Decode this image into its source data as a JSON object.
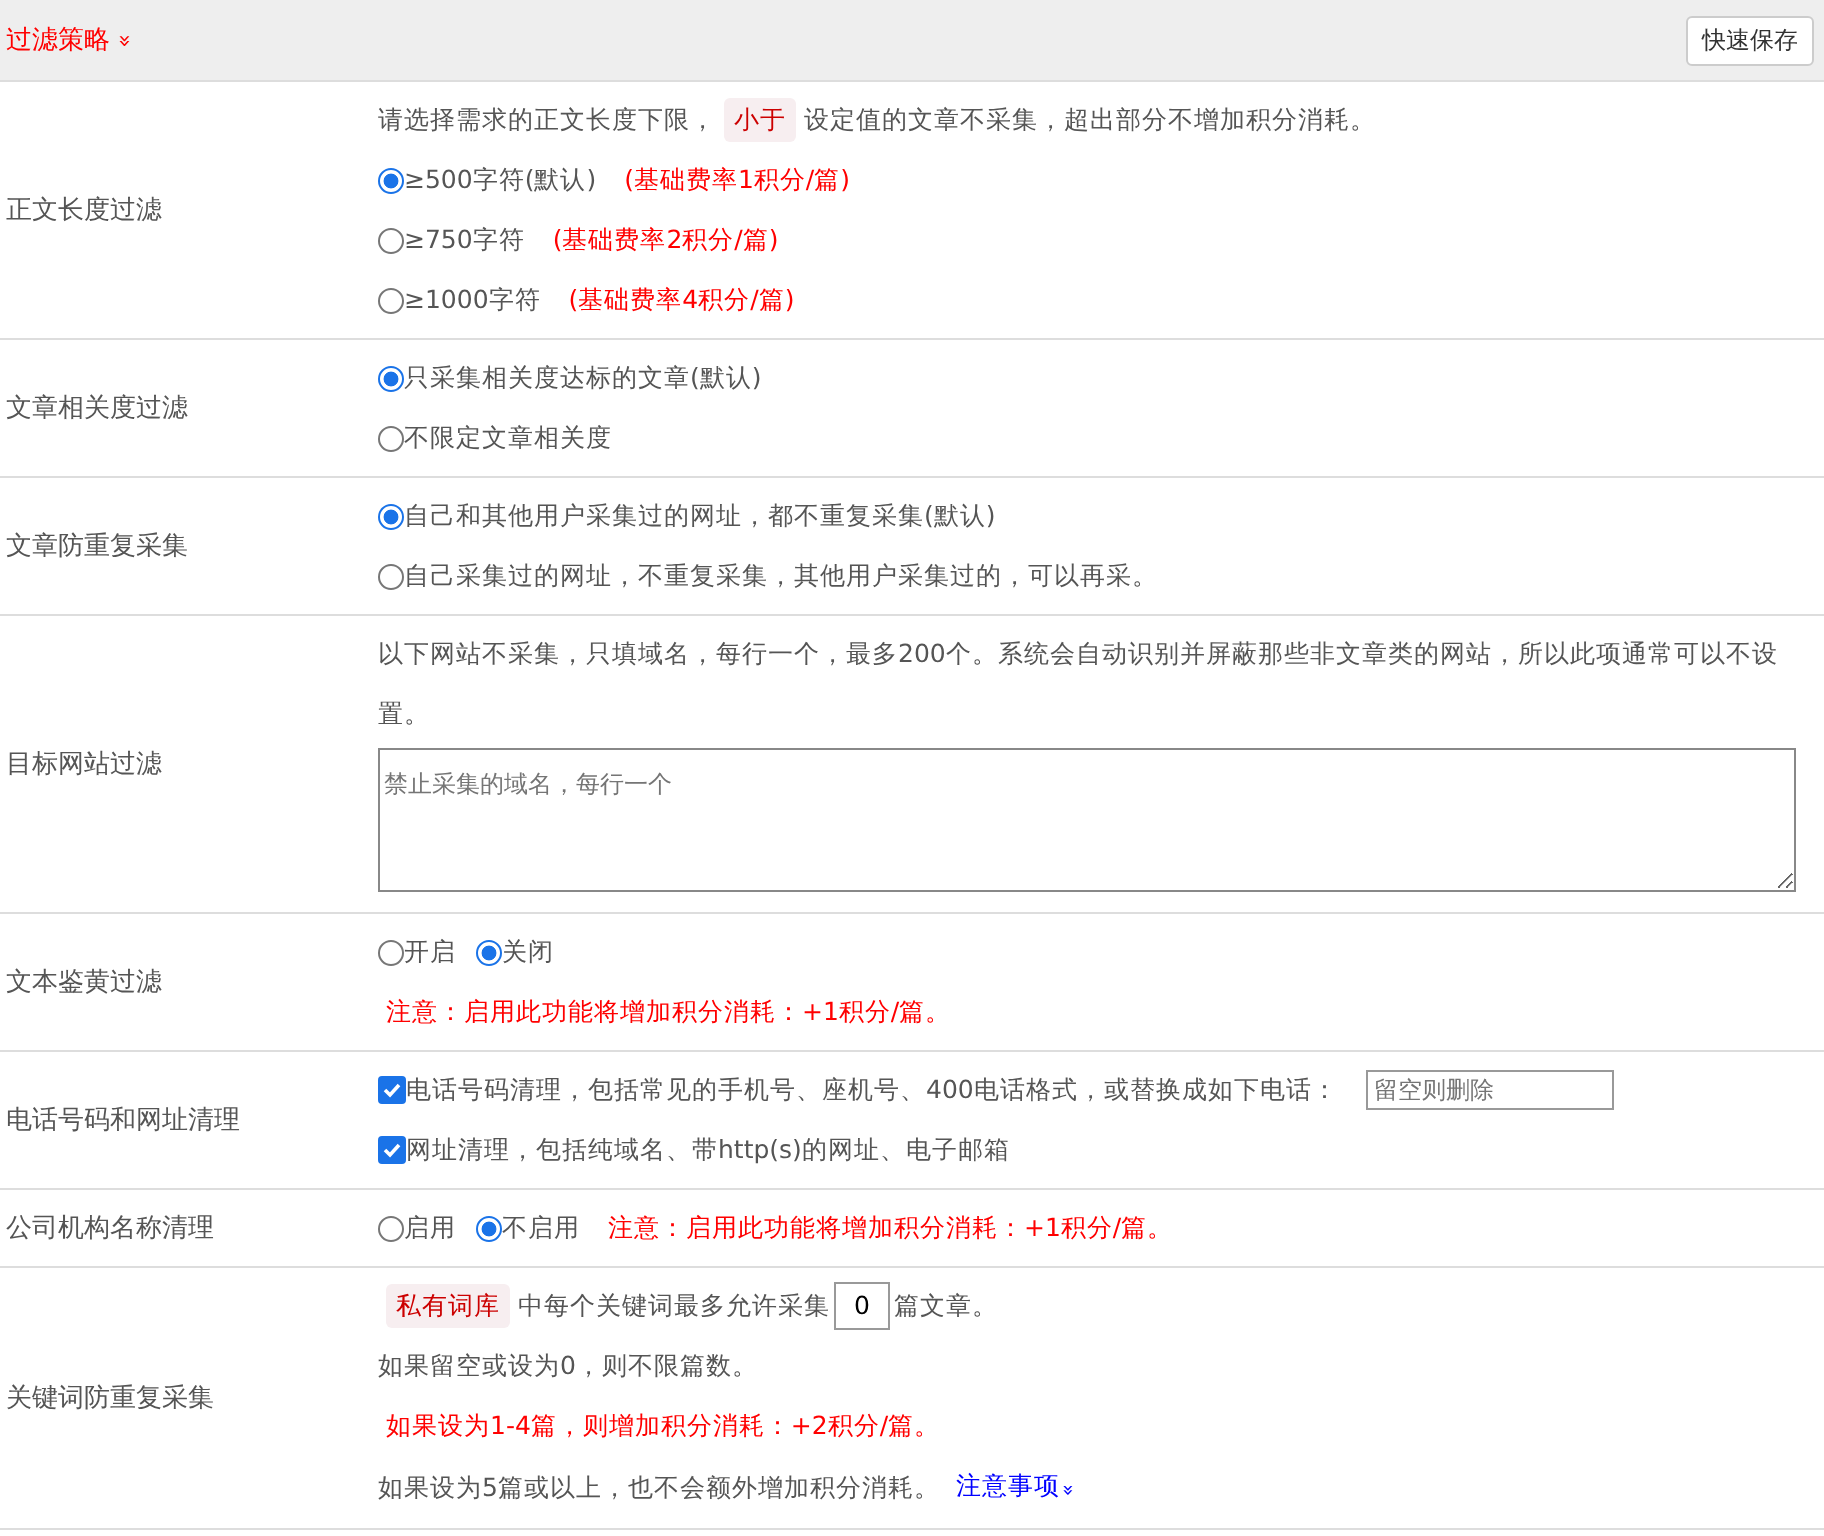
{
  "header": {
    "title": "过滤策略",
    "toggle": "»",
    "save_button": "快速保存"
  },
  "rows": [
    {
      "label": "正文长度过滤",
      "lines": [
        [
          {
            "kind": "text",
            "text": "请选择需求的正文长度下限，"
          },
          {
            "kind": "tag",
            "text": "小于"
          },
          {
            "kind": "text",
            "text": "设定值的文章不采集，超出部分不增加积分消耗。"
          }
        ],
        [
          {
            "kind": "radio",
            "text": "≥500字符(默认)",
            "selected": true
          },
          {
            "kind": "note",
            "text": "(基础费率1积分/篇)"
          }
        ],
        [
          {
            "kind": "radio",
            "text": "≥750字符",
            "selected": false
          },
          {
            "kind": "note",
            "text": "(基础费率2积分/篇)"
          }
        ],
        [
          {
            "kind": "radio",
            "text": "≥1000字符",
            "selected": false
          },
          {
            "kind": "note",
            "text": "(基础费率4积分/篇)"
          }
        ]
      ]
    },
    {
      "label": "文章相关度过滤",
      "lines": [
        [
          {
            "kind": "radio",
            "text": "只采集相关度达标的文章(默认)",
            "selected": true
          }
        ],
        [
          {
            "kind": "radio",
            "text": "不限定文章相关度",
            "selected": false
          }
        ]
      ]
    },
    {
      "label": "文章防重复采集",
      "lines": [
        [
          {
            "kind": "radio",
            "text": "自己和其他用户采集过的网址，都不重复采集(默认)",
            "selected": true
          }
        ],
        [
          {
            "kind": "radio",
            "text": "自己采集过的网址，不重复采集，其他用户采集过的，可以再采。",
            "selected": false
          }
        ]
      ]
    },
    {
      "label": "目标网站过滤",
      "lines": [
        [
          {
            "kind": "text",
            "text": "以下网站不采集，只填域名，每行一个，最多200个。系统会自动识别并屏蔽那些非文章类的网站，所以此项通常可以不设置。"
          }
        ],
        [
          {
            "kind": "textarea",
            "placeholder": "禁止采集的域名，每行一个"
          }
        ]
      ]
    },
    {
      "label": "文本鉴黄过滤",
      "lines": [
        [
          {
            "kind": "radio",
            "text": "开启",
            "selected": false
          },
          {
            "kind": "radio",
            "text": "关闭",
            "selected": true
          }
        ],
        [
          {
            "kind": "note",
            "text": "注意：启用此功能将增加积分消耗：+1积分/篇。"
          }
        ]
      ]
    },
    {
      "label": "电话号码和网址清理",
      "lines": [
        [
          {
            "kind": "checkbox",
            "text": "电话号码清理，包括常见的手机号、座机号、400电话格式，或替换成如下电话：",
            "checked": true
          },
          {
            "kind": "input",
            "placeholder": "留空则删除"
          }
        ],
        [
          {
            "kind": "checkbox",
            "text": "网址清理，包括纯域名、带http(s)的网址、电子邮箱",
            "checked": true
          }
        ]
      ]
    },
    {
      "label": "公司机构名称清理",
      "lines": [
        [
          {
            "kind": "radio",
            "text": "启用",
            "selected": false
          },
          {
            "kind": "radio",
            "text": "不启用",
            "selected": true
          },
          {
            "kind": "note",
            "text": "注意：启用此功能将增加积分消耗：+1积分/篇。"
          }
        ]
      ]
    },
    {
      "label": "关键词防重复采集",
      "lines": [
        [
          {
            "kind": "tag",
            "text": "私有词库"
          },
          {
            "kind": "text",
            "text": "中每个关键词最多允许采集"
          },
          {
            "kind": "number",
            "value": "0"
          },
          {
            "kind": "text",
            "text": "篇文章。"
          }
        ],
        [
          {
            "kind": "text",
            "text": "如果留空或设为0，则不限篇数。"
          }
        ],
        [
          {
            "kind": "note",
            "text": "如果设为1-4篇，则增加积分消耗：+2积分/篇。"
          }
        ],
        [
          {
            "kind": "text",
            "text": "如果设为5篇或以上，也不会额外增加积分消耗。"
          },
          {
            "kind": "link",
            "text": "注意事项",
            "caret": "»"
          }
        ]
      ]
    }
  ]
}
